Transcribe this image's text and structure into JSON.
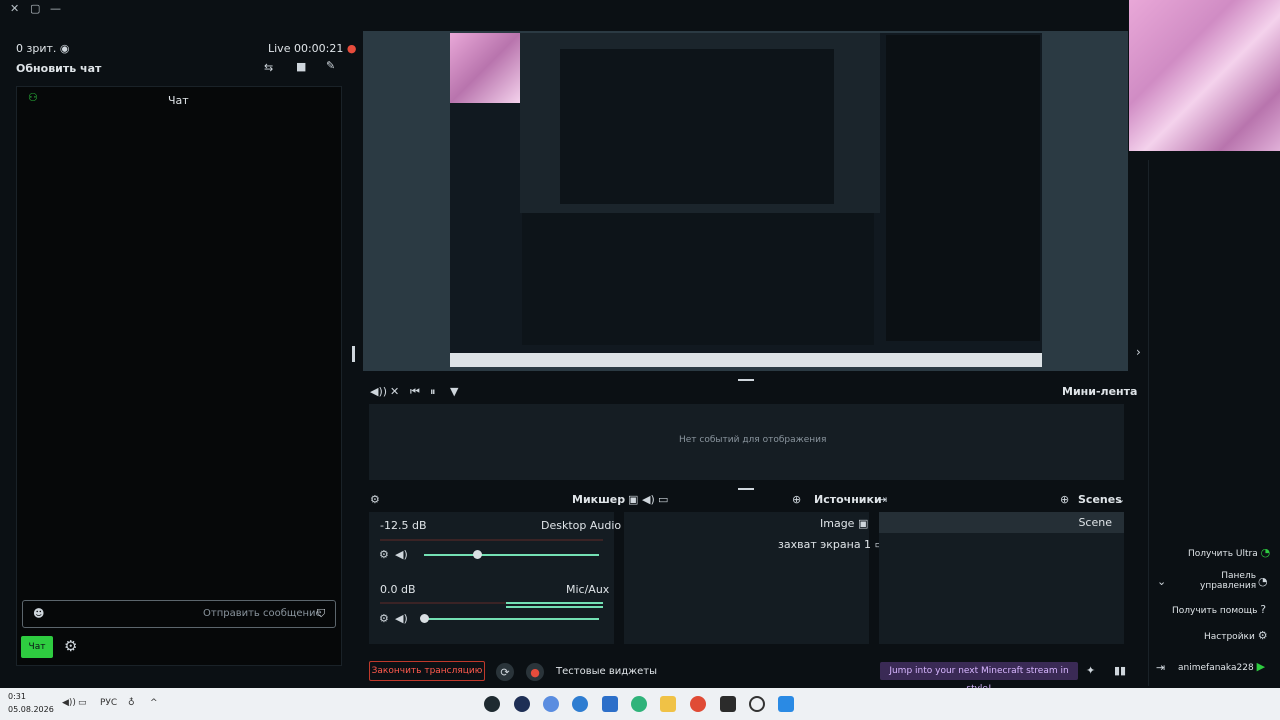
{
  "titlebar": {
    "close_icon": "close-icon",
    "maximize_icon": "maximize-icon",
    "minimize_icon": "minimize-icon"
  },
  "chat_panel": {
    "viewers": "0 зрит.",
    "live_timer": "Live 00:00:21",
    "refresh_label": "Обновить чат",
    "chat_title": "Чат",
    "input_placeholder": "Отправить сообщение",
    "send_label": "Чат"
  },
  "minilenta": {
    "title": "Мини-лента",
    "empty_text": "Нет событий для отображения"
  },
  "scenes": {
    "title": "Scenes",
    "items": [
      "Scene"
    ]
  },
  "sources": {
    "title": "Источники",
    "items": [
      "Image",
      "захват экрана 1"
    ]
  },
  "mixer": {
    "title": "Микшер",
    "channels": [
      {
        "name": "Desktop Audio",
        "level": "-12.5 dB",
        "volume": 0.3
      },
      {
        "name": "Mic/Aux",
        "level": "0.0 dB",
        "volume": 0.0
      }
    ]
  },
  "bottom_bar": {
    "end_stream": "Закончить трансляцию",
    "test_widgets": "Тестовые виджеты",
    "promo": "Jump into your next Minecraft stream in style!"
  },
  "right_panel": {
    "items": [
      {
        "label": "Получить Ultra",
        "icon": "ultra-icon"
      },
      {
        "label": "Панель управления",
        "icon": "dashboard-icon"
      },
      {
        "label": "Получить помощь",
        "icon": "help-icon"
      },
      {
        "label": "Настройки",
        "icon": "settings-icon"
      }
    ],
    "username": "animefanaka228"
  },
  "taskbar": {
    "time": "0:31",
    "date": "05.08.2026",
    "lang": "РУС"
  },
  "colors": {
    "accent": "#2ecc40",
    "live": "#e74c3c",
    "slider": "#74e0b4",
    "promo": "#3a2a55"
  }
}
